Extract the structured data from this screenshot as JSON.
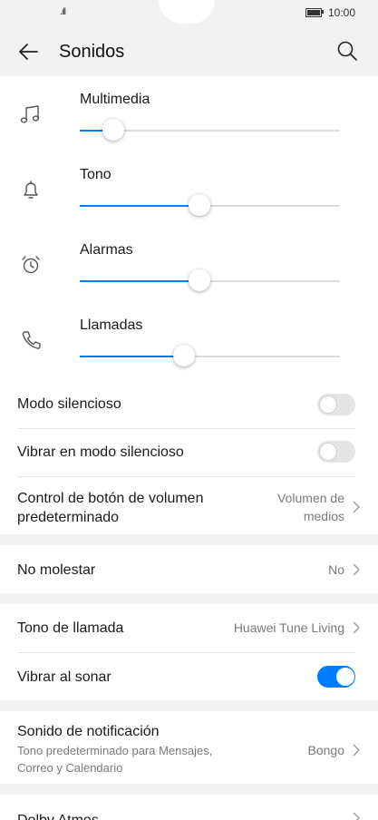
{
  "status": {
    "time": "10:00",
    "signal": ".ıll"
  },
  "header": {
    "title": "Sonidos"
  },
  "volumes": [
    {
      "label": "Multimedia",
      "level": 0.13
    },
    {
      "label": "Tono",
      "level": 0.46
    },
    {
      "label": "Alarmas",
      "level": 0.46
    },
    {
      "label": "Llamadas",
      "level": 0.4
    }
  ],
  "settings": {
    "silent_mode": {
      "label": "Modo silencioso",
      "on": false
    },
    "vibrate_silent": {
      "label": "Vibrar en modo silencioso",
      "on": false
    },
    "volume_button": {
      "label_line1": "Control de botón de volumen",
      "label_line2": "predeterminado",
      "value_line1": "Volumen de",
      "value_line2": "medios"
    },
    "dnd": {
      "label": "No molestar",
      "value": "No"
    },
    "ringtone": {
      "label": "Tono de llamada",
      "value": "Huawei Tune Living"
    },
    "vibrate_ring": {
      "label": "Vibrar al sonar",
      "on": true
    },
    "notification": {
      "label": "Sonido de notificación",
      "sub_line1": "Tono predeterminado para Mensajes,",
      "sub_line2": "Correo y Calendario",
      "value": "Bongo"
    },
    "dolby": {
      "label": "Dolby Atmos"
    }
  },
  "colors": {
    "accent": "#007dff",
    "background": "#f2f2f2"
  }
}
